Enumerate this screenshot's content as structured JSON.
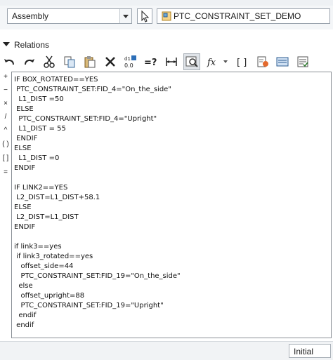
{
  "look_in": {
    "select_value": "Assembly",
    "model_name": "PTC_CONSTRAINT_SET_DEMO"
  },
  "relations": {
    "title": "Relations"
  },
  "toolbar": {
    "buttons": [
      {
        "name": "undo-icon"
      },
      {
        "name": "redo-icon"
      },
      {
        "name": "cut-icon"
      },
      {
        "name": "copy-icon"
      },
      {
        "name": "paste-icon"
      },
      {
        "name": "delete-icon"
      },
      {
        "name": "decimal-icon"
      },
      {
        "name": "evaluate-icon"
      },
      {
        "name": "insert-dimension-icon"
      },
      {
        "name": "locate-icon"
      },
      {
        "name": "function-icon"
      },
      {
        "name": "parameters-icon"
      },
      {
        "name": "verify-icon"
      },
      {
        "name": "sort-icon"
      },
      {
        "name": "units-icon"
      }
    ]
  },
  "side_operators": [
    "+",
    "−",
    "×",
    "/",
    "^",
    "( )",
    "[ ]",
    "="
  ],
  "editor_lines": [
    "IF BOX_ROTATED==YES",
    " PTC_CONSTRAINT_SET:FID_4=\"On_the_side\"",
    "  L1_DIST =50",
    " ELSE",
    "  PTC_CONSTRAINT_SET:FID_4=\"Upright\"",
    "  L1_DIST = 55",
    " ENDIF",
    "ELSE",
    "  L1_DIST =0",
    "ENDIF",
    "",
    "IF LINK2==YES",
    " L2_DIST=L1_DIST+58.1",
    "ELSE",
    " L2_DIST=L1_DIST",
    "ENDIF",
    "",
    "if link3==yes",
    " if link3_rotated==yes",
    "   offset_side=44",
    "   PTC_CONSTRAINT_SET:FID_19=\"On_the_side\"",
    "  else",
    "   offset_upright=88",
    "   PTC_CONSTRAINT_SET:FID_19=\"Upright\"",
    "  endif",
    " endif"
  ],
  "status": {
    "mode_value": "Initial"
  }
}
